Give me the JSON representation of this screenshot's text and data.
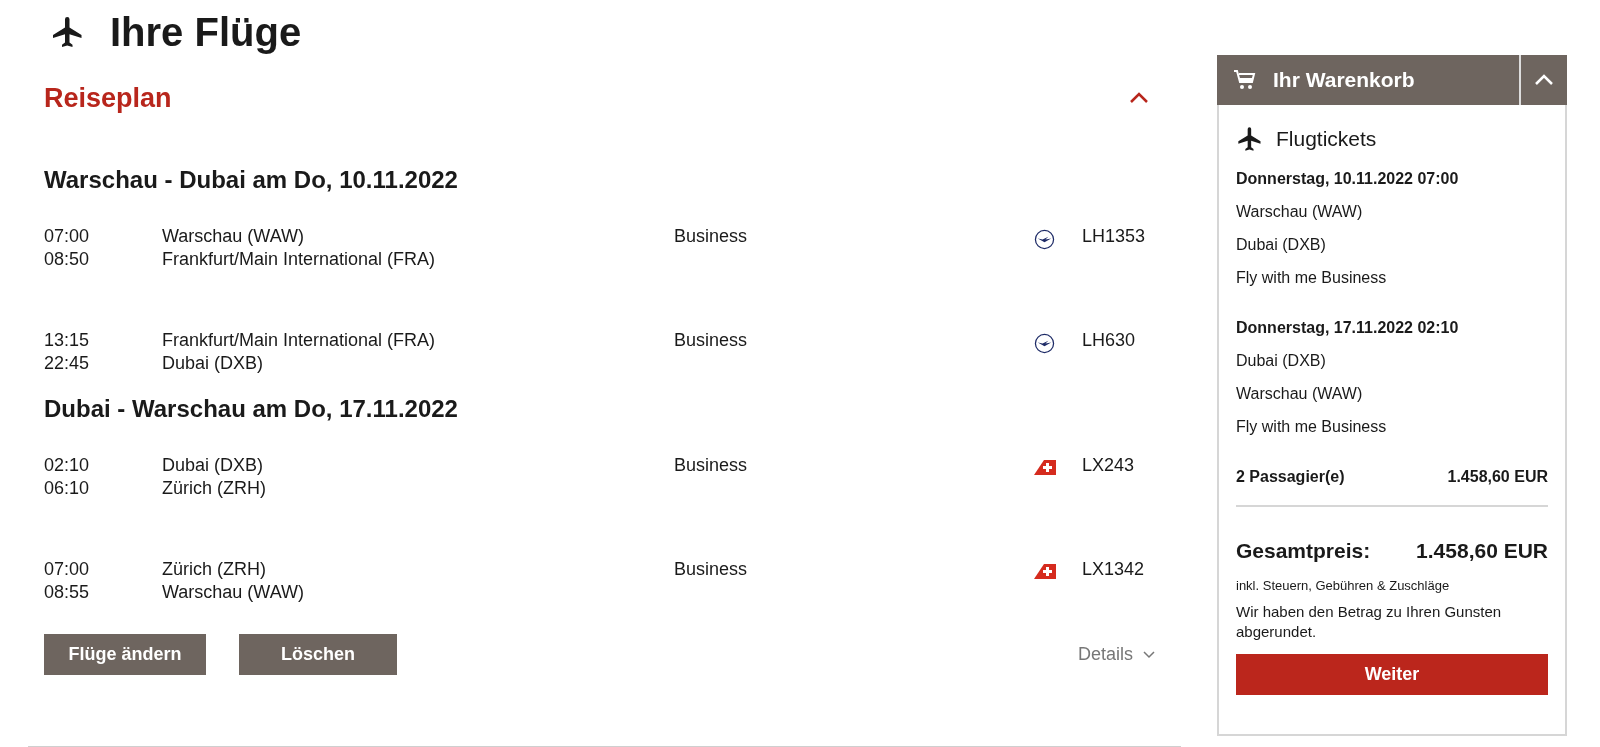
{
  "page_title": "Ihre Flüge",
  "itinerary": {
    "title": "Reiseplan",
    "expanded": true,
    "journeys": [
      {
        "heading": "Warschau - Dubai am Do, 10.11.2022",
        "flights": [
          {
            "departure_time": "07:00",
            "arrival_time": "08:50",
            "origin": "Warschau (WAW)",
            "destination": "Frankfurt/Main International (FRA)",
            "cabin": "Business",
            "kind": "circle",
            "flight_number": "LH1353"
          },
          {
            "departure_time": "13:15",
            "arrival_time": "22:45",
            "origin": "Frankfurt/Main International (FRA)",
            "destination": "Dubai (DXB)",
            "cabin": "Business",
            "kind": "circle",
            "flight_number": "LH630"
          }
        ]
      },
      {
        "heading": "Dubai - Warschau am Do, 17.11.2022",
        "flights": [
          {
            "departure_time": "02:10",
            "arrival_time": "06:10",
            "origin": "Dubai (DXB)",
            "destination": "Zürich (ZRH)",
            "cabin": "Business",
            "kind": "tail",
            "flight_number": "LX243"
          },
          {
            "departure_time": "07:00",
            "arrival_time": "08:55",
            "origin": "Zürich (ZRH)",
            "destination": "Warschau (WAW)",
            "cabin": "Business",
            "kind": "tail",
            "flight_number": "LX1342"
          }
        ]
      }
    ],
    "buttons": [
      "Flüge ändern",
      "Löschen"
    ],
    "details_link": "Details"
  },
  "cart": {
    "title": "Ihr Warenkorb",
    "expanded": true,
    "section_title": "Flugtickets",
    "items": [
      {
        "date": "Donnerstag, 10.11.2022 07:00",
        "origin": "Warschau (WAW)",
        "destination": "Dubai (DXB)",
        "fare": "Fly with me Business"
      },
      {
        "date": "Donnerstag, 17.11.2022 02:10",
        "origin": "Dubai (DXB)",
        "destination": "Warschau (WAW)",
        "fare": "Fly with me Business"
      }
    ],
    "passengers_label": "2 Passagier(e)",
    "passengers_price": "1.458,60 EUR",
    "total_label": "Gesamtpreis:",
    "total_price": "1.458,60 EUR",
    "tax_note": "inkl. Steuern, Gebühren & Zuschläge",
    "rounding_note": "Wir haben den Betrag zu Ihren Gunsten abgerundet.",
    "continue_button": "Weiter"
  }
}
